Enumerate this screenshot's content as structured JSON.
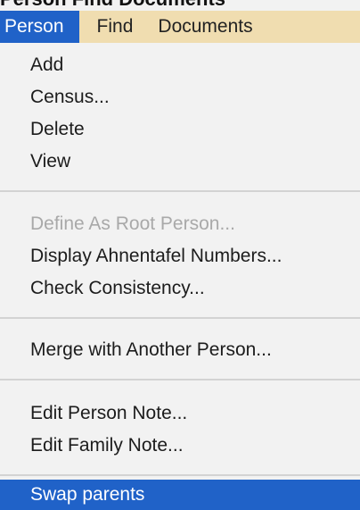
{
  "caption": "Person Find Documents",
  "menubar": {
    "items": [
      {
        "label": "Person"
      },
      {
        "label": "Find"
      },
      {
        "label": "Documents"
      }
    ]
  },
  "menu": {
    "items": [
      {
        "label": "Add",
        "enabled": true
      },
      {
        "label": "Census...",
        "enabled": true
      },
      {
        "label": "Delete",
        "enabled": true
      },
      {
        "label": "View",
        "enabled": true
      },
      {
        "label": "Define As Root Person...",
        "enabled": false
      },
      {
        "label": "Display Ahnentafel Numbers...",
        "enabled": true
      },
      {
        "label": "Check Consistency...",
        "enabled": true
      },
      {
        "label": "Merge with Another Person...",
        "enabled": true
      },
      {
        "label": "Edit Person Note...",
        "enabled": true
      },
      {
        "label": "Edit Family Note...",
        "enabled": true
      },
      {
        "label": "Swap parents",
        "enabled": true,
        "highlighted": true
      }
    ]
  },
  "colors": {
    "menubar_background": "#f0ddb0",
    "selection": "#2062c8",
    "menu_background": "#f2f2f2",
    "disabled_text": "#a9a9a9"
  }
}
